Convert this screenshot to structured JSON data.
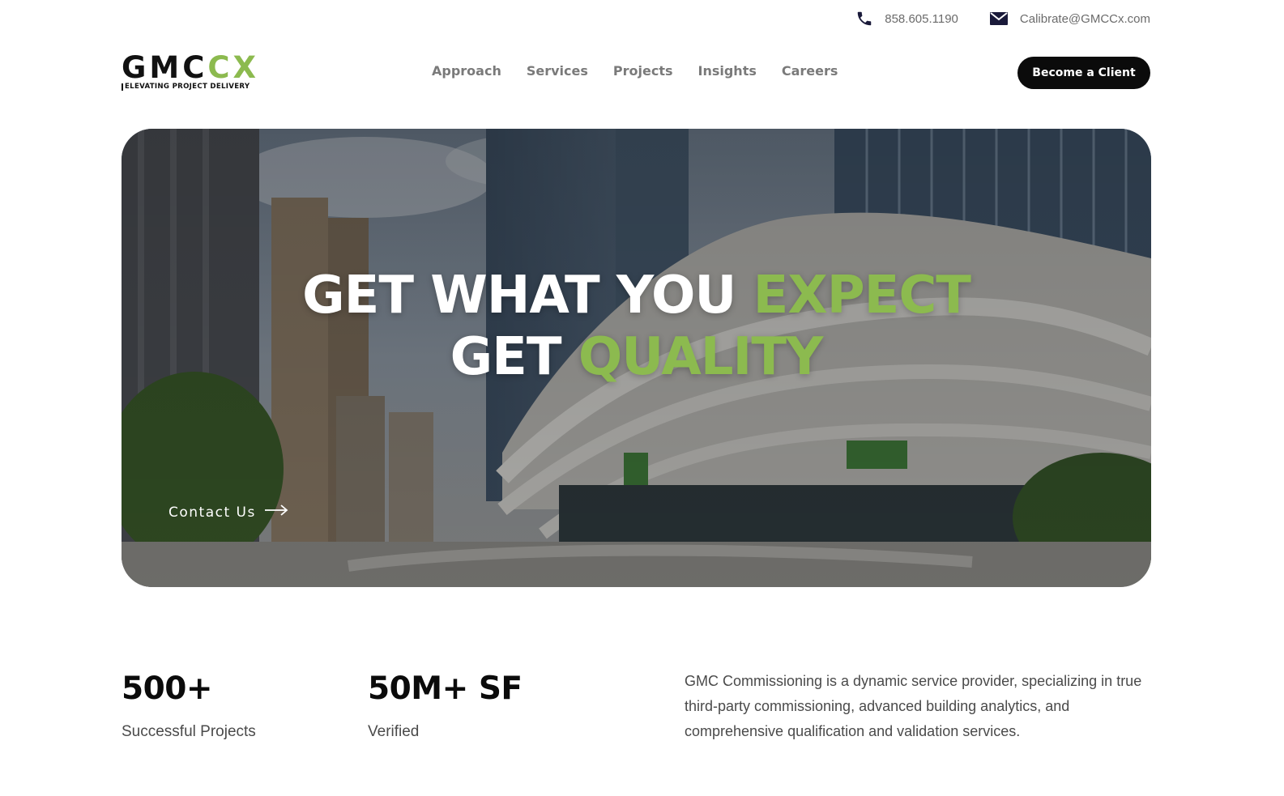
{
  "topbar": {
    "phone": {
      "icon": "phone-icon",
      "text": "858.605.1190"
    },
    "email": {
      "icon": "mail-icon",
      "text": "Calibrate@GMCCx.com"
    }
  },
  "logo": {
    "mark_gmc": "GMC",
    "mark_cx": "CX",
    "tagline": "ELEVATING PROJECT DELIVERY"
  },
  "nav": {
    "items": [
      {
        "label": "Approach"
      },
      {
        "label": "Services"
      },
      {
        "label": "Projects"
      },
      {
        "label": "Insights"
      },
      {
        "label": "Careers"
      }
    ]
  },
  "cta": {
    "label": "Become a Client"
  },
  "hero": {
    "line1_white": "GET WHAT YOU ",
    "line1_accent": "EXPECT",
    "line2_white": "GET ",
    "line2_accent": "QUALITY",
    "contact_label": "Contact Us",
    "contact_icon": "arrow-right-icon"
  },
  "stats": [
    {
      "value": "500+",
      "label": "Successful Projects"
    },
    {
      "value": "50M+ SF",
      "label": "Verified"
    }
  ],
  "about": {
    "text": "GMC Commissioning is a dynamic service provider, specializing in true third-party commissioning, advanced building analytics, and comprehensive qualification and validation services."
  },
  "colors": {
    "accent": "#8cba4f",
    "cta_bg": "#0b0b0b",
    "nav_text": "#7a7a7a"
  }
}
